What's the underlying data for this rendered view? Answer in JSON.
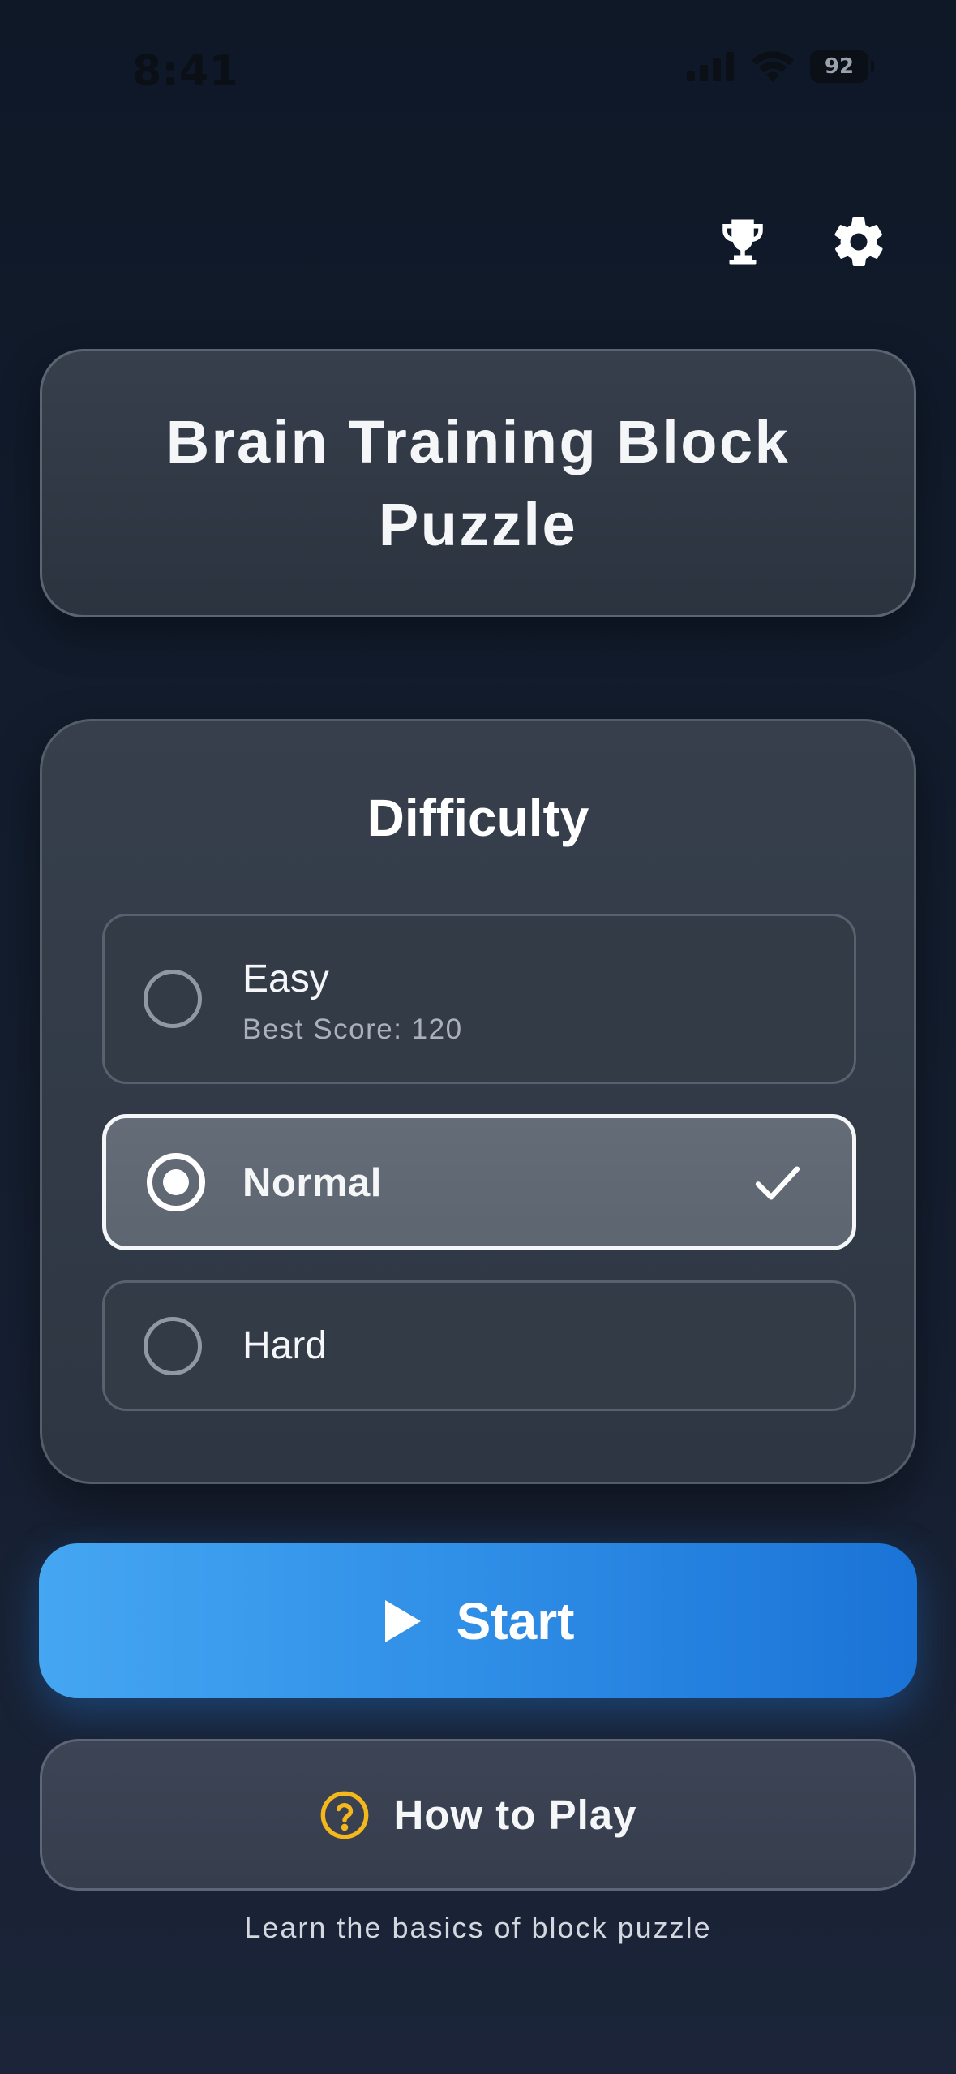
{
  "status_bar": {
    "time": "8:41",
    "battery": "92",
    "icons": [
      "signal-icon",
      "wifi-icon",
      "battery-icon"
    ]
  },
  "header": {
    "icons": [
      "trophy-icon",
      "gear-icon"
    ]
  },
  "title": "Brain Training Block Puzzle",
  "difficulty": {
    "heading": "Difficulty",
    "options": [
      {
        "label": "Easy",
        "sub": "Best Score: 120",
        "selected": false
      },
      {
        "label": "Normal",
        "selected": true
      },
      {
        "label": "Hard",
        "selected": false
      }
    ]
  },
  "start": {
    "label": "Start",
    "icon": "play-icon"
  },
  "how_to_play": {
    "label": "How to Play",
    "icon": "help-circle-icon",
    "caption": "Learn the basics of block puzzle"
  },
  "colors": {
    "accent_start": "#45a6f2",
    "accent_end": "#1a73d6",
    "help_icon": "#f5b81c",
    "background": "#0e1827"
  }
}
